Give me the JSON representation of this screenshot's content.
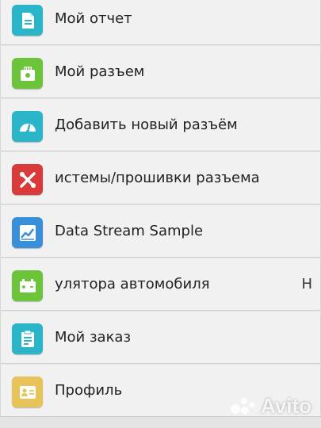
{
  "menu": {
    "items": [
      {
        "label": "Мой отчет",
        "icon": "document-icon",
        "color": "#2bb5c8"
      },
      {
        "label": "Мой разъем",
        "icon": "connector-icon",
        "color": "#6cc43a"
      },
      {
        "label": "Добавить новый разъём",
        "icon": "gauge-icon",
        "color": "#2bb5c8"
      },
      {
        "label": "истемы/прошивки разъема",
        "icon": "tools-icon",
        "color": "#d93a3a"
      },
      {
        "label": "Data Stream Sample",
        "icon": "chart-icon",
        "color": "#3a8fd9"
      },
      {
        "label": "улятора автомобиля",
        "icon": "battery-icon",
        "color": "#6cc43a",
        "right_text": "Н"
      },
      {
        "label": "Мой заказ",
        "icon": "clipboard-icon",
        "color": "#2bb5c8"
      },
      {
        "label": "Профиль",
        "icon": "id-card-icon",
        "color": "#e8c35a"
      }
    ]
  },
  "watermark": {
    "text": "Avito"
  }
}
